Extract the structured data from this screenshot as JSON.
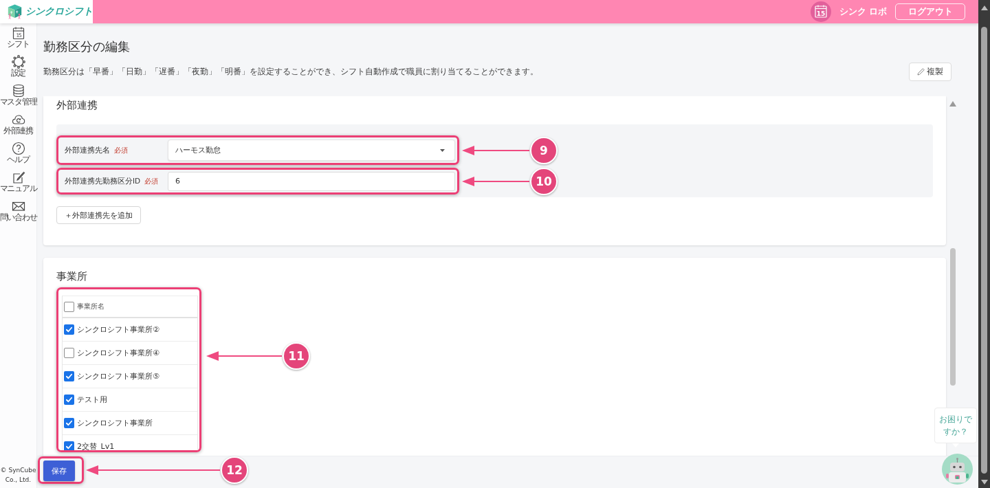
{
  "header": {
    "logo_text": "シンクロシフト",
    "calendar_day": "15",
    "user_name": "シンク ロボ",
    "logout_button": "ログアウト"
  },
  "sidebar": {
    "items": [
      {
        "label": "シフト",
        "icon_text": "15"
      },
      {
        "label": "設定"
      },
      {
        "label": "マスタ管理"
      },
      {
        "label": "外部連携"
      },
      {
        "label": "ヘルプ"
      },
      {
        "label": "マニュアル"
      },
      {
        "label": "問い合わせ"
      }
    ],
    "copyright": "© SynCube Co., Ltd."
  },
  "page": {
    "title": "勤務区分の編集",
    "description": "勤務区分は「早番」「日勤」「遅番」「夜勤」「明番」を設定することができ、シフト自動作成で職員に割り当てることができます。",
    "copy_button": "複製"
  },
  "external_section": {
    "title": "外部連携",
    "fields": [
      {
        "kind": "select",
        "label": "外部連携先名",
        "required": "必須",
        "value": "ハーモス勤怠"
      },
      {
        "kind": "input",
        "label": "外部連携先勤務区分ID",
        "required": "必須",
        "value": "6"
      }
    ],
    "add_button": "＋外部連携先を追加"
  },
  "office_section": {
    "title": "事業所",
    "table": {
      "header": {
        "label": "事業所名",
        "checked": false
      },
      "rows": [
        {
          "name": "シンクロシフト事業所②",
          "checked": true
        },
        {
          "name": "シンクロシフト事業所④",
          "checked": false
        },
        {
          "name": "シンクロシフト事業所⑤",
          "checked": true
        },
        {
          "name": "テスト用",
          "checked": true
        },
        {
          "name": "シンクロシフト事業所",
          "checked": true
        },
        {
          "name": "2交替_Lv1",
          "checked": true
        }
      ]
    }
  },
  "save_button": "保存",
  "help_bubble": {
    "lines": [
      "お困りで",
      "すか？"
    ]
  },
  "annotations": [
    "9",
    "10",
    "11",
    "12"
  ]
}
